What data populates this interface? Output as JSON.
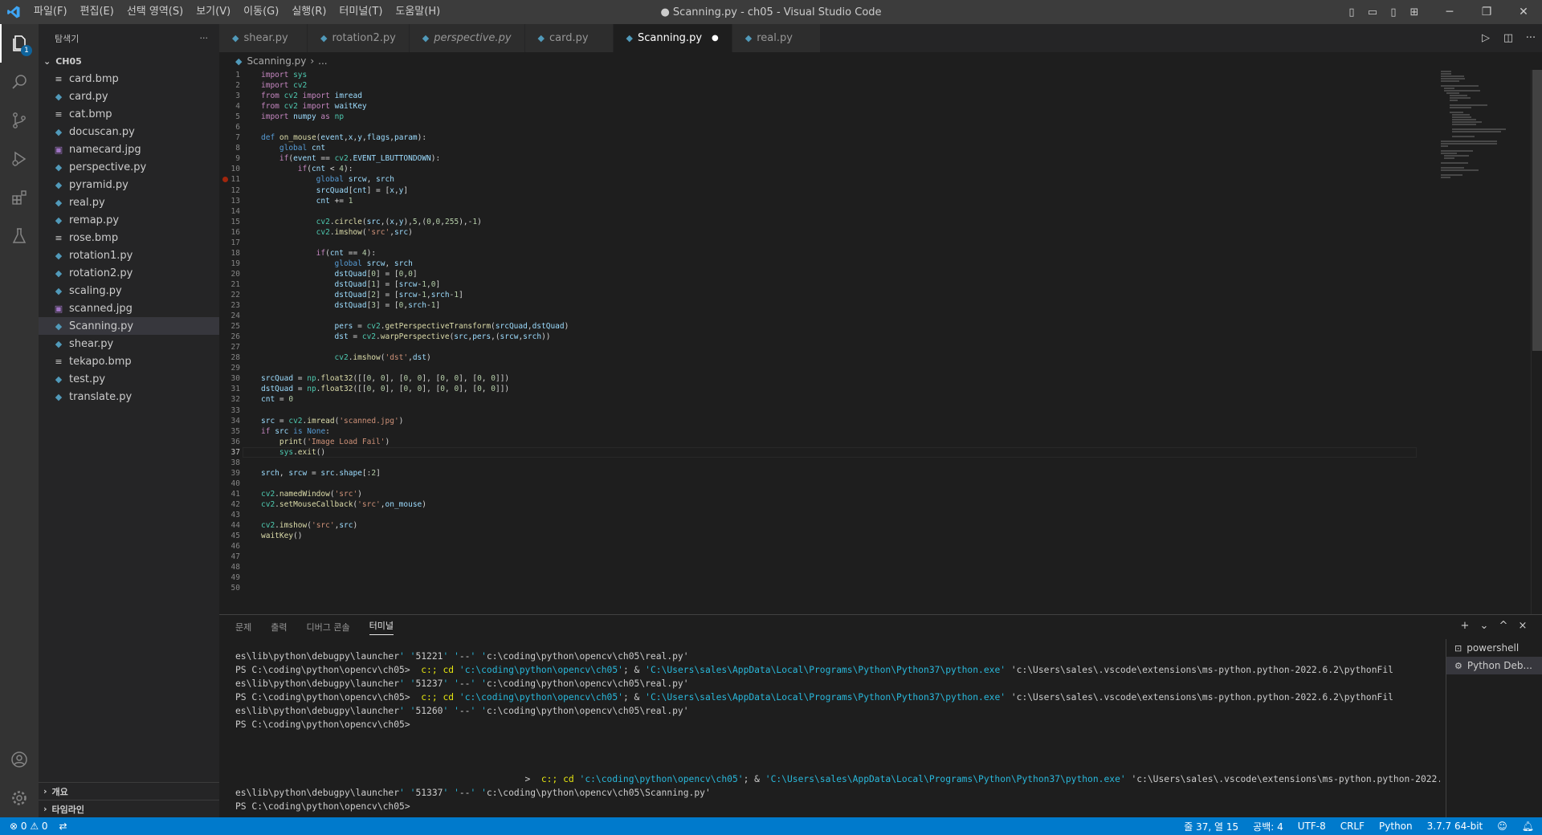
{
  "menu": [
    "파일(F)",
    "편집(E)",
    "선택 영역(S)",
    "보기(V)",
    "이동(G)",
    "실행(R)",
    "터미널(T)",
    "도움말(H)"
  ],
  "window_title": "● Scanning.py - ch05 - Visual Studio Code",
  "activity_badge": "1",
  "sidebar": {
    "title": "탐색기",
    "more": "···",
    "folder": "CH05",
    "files": [
      {
        "name": "card.bmp",
        "type": "bmp"
      },
      {
        "name": "card.py",
        "type": "py"
      },
      {
        "name": "cat.bmp",
        "type": "bmp"
      },
      {
        "name": "docuscan.py",
        "type": "py"
      },
      {
        "name": "namecard.jpg",
        "type": "img"
      },
      {
        "name": "perspective.py",
        "type": "py"
      },
      {
        "name": "pyramid.py",
        "type": "py"
      },
      {
        "name": "real.py",
        "type": "py"
      },
      {
        "name": "remap.py",
        "type": "py"
      },
      {
        "name": "rose.bmp",
        "type": "bmp"
      },
      {
        "name": "rotation1.py",
        "type": "py"
      },
      {
        "name": "rotation2.py",
        "type": "py"
      },
      {
        "name": "scaling.py",
        "type": "py"
      },
      {
        "name": "scanned.jpg",
        "type": "img"
      },
      {
        "name": "Scanning.py",
        "type": "py",
        "selected": true
      },
      {
        "name": "shear.py",
        "type": "py"
      },
      {
        "name": "tekapo.bmp",
        "type": "bmp"
      },
      {
        "name": "test.py",
        "type": "py"
      },
      {
        "name": "translate.py",
        "type": "py"
      }
    ],
    "outline": "개요",
    "timeline": "타임라인"
  },
  "tabs": [
    {
      "label": "shear.py"
    },
    {
      "label": "rotation2.py"
    },
    {
      "label": "perspective.py",
      "italic": true
    },
    {
      "label": "card.py"
    },
    {
      "label": "Scanning.py",
      "active": true,
      "modified": true
    },
    {
      "label": "real.py"
    }
  ],
  "breadcrumb": {
    "file": "Scanning.py",
    "rest": "..."
  },
  "editor": {
    "current_line": 37,
    "breakpoint_line": 11,
    "lines": [
      "import sys",
      "import cv2",
      "from cv2 import imread",
      "from cv2 import waitKey",
      "import numpy as np",
      "",
      "def on_mouse(event,x,y,flags,param):",
      "    global cnt",
      "    if(event == cv2.EVENT_LBUTTONDOWN):",
      "        if(cnt < 4):",
      "            global srcw, srch",
      "            srcQuad[cnt] = [x,y]",
      "            cnt += 1",
      "",
      "            cv2.circle(src,(x,y),5,(0,0,255),-1)",
      "            cv2.imshow('src',src)",
      "",
      "            if(cnt == 4):",
      "                global srcw, srch",
      "                dstQuad[0] = [0,0]",
      "                dstQuad[1] = [srcw-1,0]",
      "                dstQuad[2] = [srcw-1,srch-1]",
      "                dstQuad[3] = [0,srch-1]",
      "",
      "                pers = cv2.getPerspectiveTransform(srcQuad,dstQuad)",
      "                dst = cv2.warpPerspective(src,pers,(srcw,srch))",
      "",
      "                cv2.imshow('dst',dst)",
      "",
      "srcQuad = np.float32([[0, 0], [0, 0], [0, 0], [0, 0]])",
      "dstQuad = np.float32([[0, 0], [0, 0], [0, 0], [0, 0]])",
      "cnt = 0",
      "",
      "src = cv2.imread('scanned.jpg')",
      "if src is None:",
      "    print('Image Load Fail')",
      "    sys.exit()",
      "",
      "srch, srcw = src.shape[:2]",
      "",
      "cv2.namedWindow('src')",
      "cv2.setMouseCallback('src',on_mouse)",
      "",
      "cv2.imshow('src',src)",
      "waitKey()",
      "",
      "",
      "",
      "",
      ""
    ]
  },
  "panel": {
    "tabs": [
      "문제",
      "출력",
      "디버그 콘솔",
      "터미널"
    ],
    "active_tab": "터미널",
    "actions": [
      "+",
      "⌄",
      "^",
      "×"
    ],
    "terminal_lines": [
      "es\\lib\\python\\debugpy\\launcher' '51221' '--' 'c:\\coding\\python\\opencv\\ch05\\real.py'",
      "PS C:\\coding\\python\\opencv\\ch05>  c:; cd 'c:\\coding\\python\\opencv\\ch05'; & 'C:\\Users\\sales\\AppData\\Local\\Programs\\Python\\Python37\\python.exe' 'c:\\Users\\sales\\.vscode\\extensions\\ms-python.python-2022.6.2\\pythonFil",
      "es\\lib\\python\\debugpy\\launcher' '51237' '--' 'c:\\coding\\python\\opencv\\ch05\\real.py'",
      "PS C:\\coding\\python\\opencv\\ch05>  c:; cd 'c:\\coding\\python\\opencv\\ch05'; & 'C:\\Users\\sales\\AppData\\Local\\Programs\\Python\\Python37\\python.exe' 'c:\\Users\\sales\\.vscode\\extensions\\ms-python.python-2022.6.2\\pythonFil",
      "es\\lib\\python\\debugpy\\launcher' '51260' '--' 'c:\\coding\\python\\opencv\\ch05\\real.py'",
      "PS C:\\coding\\python\\opencv\\ch05>",
      "",
      "",
      "",
      "                                                     >  c:; cd 'c:\\coding\\python\\opencv\\ch05'; & 'C:\\Users\\sales\\AppData\\Local\\Programs\\Python\\Python37\\python.exe' 'c:\\Users\\sales\\.vscode\\extensions\\ms-python.python-2022.6.2\\pythonFil",
      "es\\lib\\python\\debugpy\\launcher' '51337' '--' 'c:\\coding\\python\\opencv\\ch05\\Scanning.py'",
      "PS C:\\coding\\python\\opencv\\ch05>"
    ],
    "terminal_list": [
      {
        "label": "powershell",
        "icon": "⊡"
      },
      {
        "label": "Python Deb...",
        "icon": "⚙",
        "selected": true
      }
    ]
  },
  "status": {
    "errors": "⊗ 0 ⚠ 0",
    "position": "줄 37, 열 15",
    "spaces": "공백: 4",
    "encoding": "UTF-8",
    "eol": "CRLF",
    "language": "Python",
    "interpreter": "3.7.7 64-bit"
  },
  "colors": {
    "accent": "#007acc",
    "titlebar": "#3c3c3c",
    "activitybar": "#333333",
    "sidebar": "#252526",
    "editor": "#1e1e1e"
  }
}
